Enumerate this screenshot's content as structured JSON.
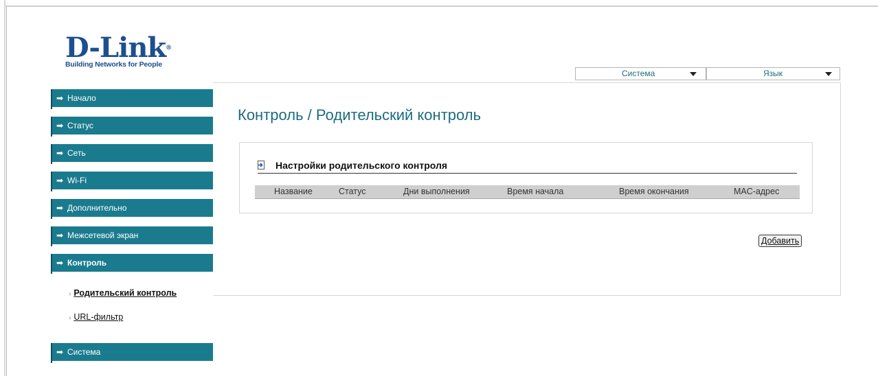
{
  "brand": {
    "logo_name": "D-Link",
    "logo_reg": "®",
    "tagline": "Building Networks for People"
  },
  "header": {
    "system_dropdown": {
      "value": "Система"
    },
    "language_dropdown": {
      "value": "Язык"
    }
  },
  "sidebar": {
    "items": [
      {
        "label": "Начало",
        "icon": "arrow-right-icon"
      },
      {
        "label": "Статус",
        "icon": "arrow-right-icon"
      },
      {
        "label": "Сеть",
        "icon": "arrow-right-icon"
      },
      {
        "label": "Wi-Fi",
        "icon": "arrow-right-icon"
      },
      {
        "label": "Дополнительно",
        "icon": "arrow-right-icon"
      },
      {
        "label": "Межсетевой экран",
        "icon": "arrow-right-icon"
      },
      {
        "label": "Контроль",
        "icon": "arrow-right-icon",
        "active": true
      },
      {
        "label": "Система",
        "icon": "arrow-right-icon"
      }
    ],
    "sub_items": [
      {
        "label": "Родительский контроль",
        "current": true
      },
      {
        "label": "URL-фильтр"
      }
    ]
  },
  "main": {
    "title": "Контроль /  Родительский контроль",
    "panel": {
      "title": "Настройки родительского контроля",
      "columns": [
        "Название",
        "Статус",
        "Дни выполнения",
        "Время начала",
        "Время окончания",
        "MAC-адрес"
      ]
    },
    "add_button": "Добавить"
  },
  "colors": {
    "nav_bg": "#1b7b8e",
    "title": "#1d6b82",
    "brand": "#1d4e8f"
  }
}
